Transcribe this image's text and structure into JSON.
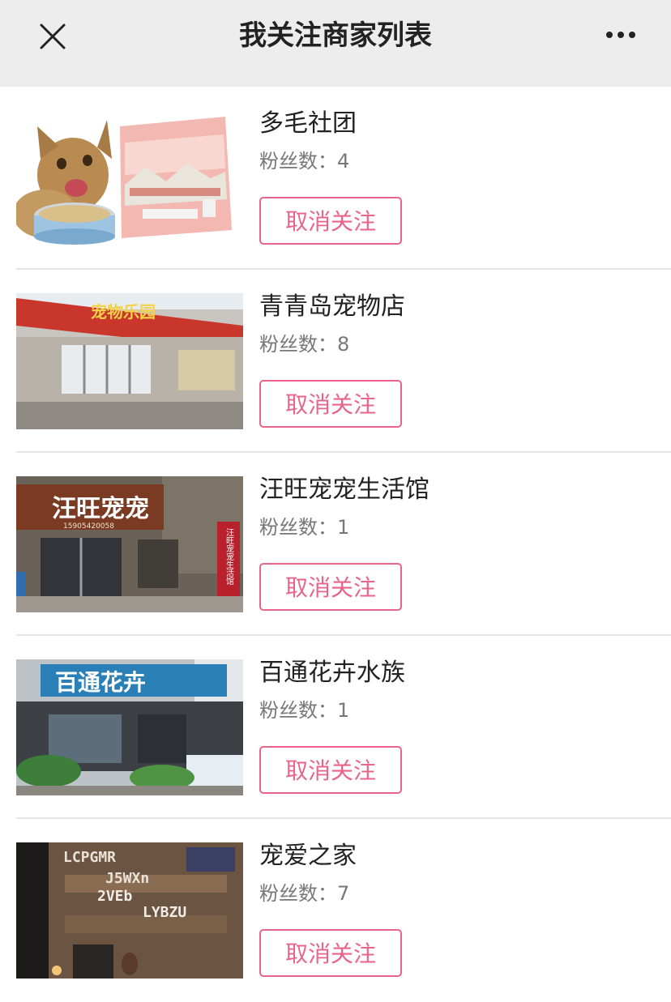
{
  "header": {
    "title": "我关注商家列表",
    "close_icon": "close-icon",
    "more_icon": "more-icon"
  },
  "colors": {
    "accent": "#e8648a",
    "header_bg": "#ededed",
    "divider": "#e5e5e5"
  },
  "merchants": [
    {
      "name": "多毛社团",
      "fans_label": "粉丝数：",
      "fans": "4",
      "button_label": "取消关注",
      "image": "cat-food-product-photo"
    },
    {
      "name": "青青岛宠物店",
      "fans_label": "粉丝数：",
      "fans": "8",
      "button_label": "取消关注",
      "image": "storefront-photo-red-sign"
    },
    {
      "name": "汪旺宠宠生活馆",
      "fans_label": "粉丝数：",
      "fans": "1",
      "button_label": "取消关注",
      "image": "storefront-photo-brick-wall"
    },
    {
      "name": "百通花卉水族",
      "fans_label": "粉丝数：",
      "fans": "1",
      "button_label": "取消关注",
      "image": "storefront-photo-blue-sign"
    },
    {
      "name": "宠爱之家",
      "fans_label": "粉丝数：",
      "fans": "7",
      "button_label": "取消关注",
      "image": "interior-photo-wood-wall"
    }
  ],
  "image_text": {
    "sign_2": "宠物乐园",
    "sign_3": "汪旺宠宠",
    "sign_3_phone": "15905420058",
    "sign_3_vertical": "汪旺宠宠生活馆",
    "sign_4": "百通花卉",
    "wall_5_line1": "LCPGMR",
    "wall_5_line2": "J5WXn",
    "wall_5_line3": "2VEb",
    "wall_5_line4": "LYBZU"
  }
}
